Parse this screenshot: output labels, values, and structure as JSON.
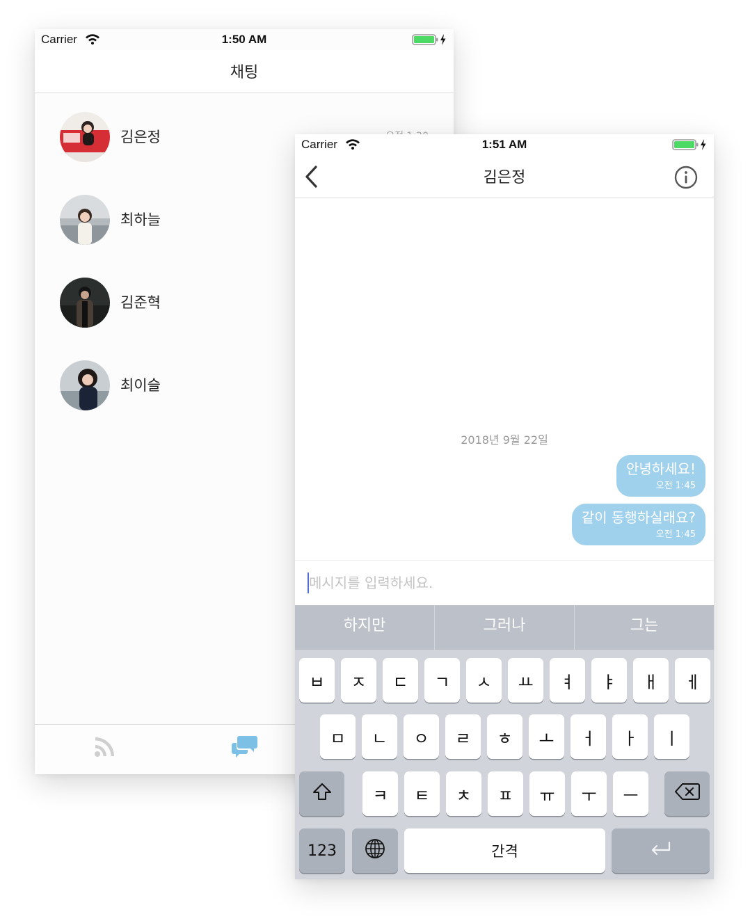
{
  "list_screen": {
    "status": {
      "carrier": "Carrier",
      "time": "1:50 AM"
    },
    "title": "채팅",
    "chats": [
      {
        "name": "김은정",
        "time": "오전 1:20",
        "avatar": "avatar-photo-red-car"
      },
      {
        "name": "최하늘",
        "avatar": "avatar-photo-lake"
      },
      {
        "name": "김준혁",
        "avatar": "avatar-photo-dark"
      },
      {
        "name": "최이슬",
        "avatar": "avatar-photo-curly-hair"
      }
    ],
    "tabs": [
      {
        "icon": "rss-feed-icon",
        "active": false
      },
      {
        "icon": "chat-bubbles-icon",
        "active": true
      }
    ]
  },
  "chat_screen": {
    "status": {
      "carrier": "Carrier",
      "time": "1:51 AM"
    },
    "title": "김은정",
    "date_separator": "2018년 9월 22일",
    "messages": [
      {
        "text": "안녕하세요!",
        "time": "오전 1:45"
      },
      {
        "text": "같이 동행하실래요?",
        "time": "오전 1:45"
      }
    ],
    "input": {
      "placeholder": "메시지를 입력하세요.",
      "value": ""
    },
    "suggestions": [
      "하지만",
      "그러나",
      "그는"
    ],
    "keyboard": {
      "row1": [
        "ㅂ",
        "ㅈ",
        "ㄷ",
        "ㄱ",
        "ㅅ",
        "ㅛ",
        "ㅕ",
        "ㅑ",
        "ㅐ",
        "ㅔ"
      ],
      "row2": [
        "ㅁ",
        "ㄴ",
        "ㅇ",
        "ㄹ",
        "ㅎ",
        "ㅗ",
        "ㅓ",
        "ㅏ",
        "ㅣ"
      ],
      "row3": [
        "ㅋ",
        "ㅌ",
        "ㅊ",
        "ㅍ",
        "ㅠ",
        "ㅜ",
        "ㅡ"
      ],
      "numbers_label": "123",
      "space_label": "간격"
    }
  },
  "colors": {
    "bubble": "#9fd0ec",
    "active_tab": "#7cc0e6",
    "inactive_tab": "#cfcfcf",
    "caret": "#4f6fd8",
    "battery": "#4cd964"
  }
}
